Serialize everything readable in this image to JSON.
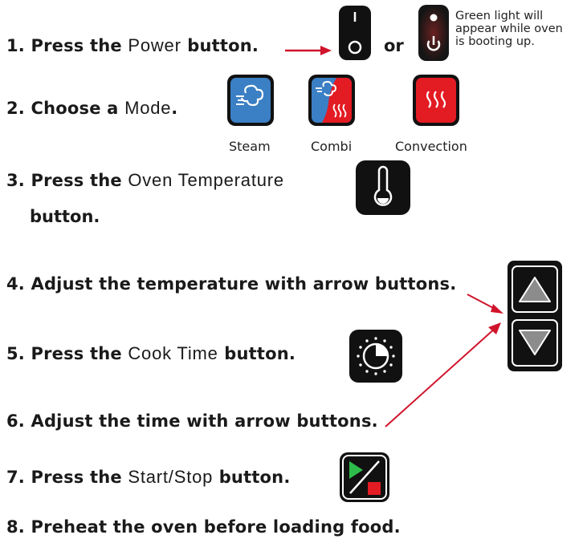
{
  "steps": {
    "s1": {
      "pre": "1. Press the ",
      "kw": "Power",
      "post": " button."
    },
    "or": "or",
    "note": [
      "Green light will",
      "appear while oven",
      "is booting up."
    ],
    "s2": {
      "pre": "2. Choose a ",
      "kw": "Mode",
      "post": "."
    },
    "modes": [
      "Steam",
      "Combi",
      "Convection"
    ],
    "s3": {
      "pre": "3. Press the ",
      "kw": "Oven Temperature",
      "post": "",
      "cont": "button."
    },
    "s4": {
      "text": "4. Adjust the temperature with arrow buttons."
    },
    "s5": {
      "pre": "5. Press the ",
      "kw": "Cook Time",
      "post": " button."
    },
    "s6": {
      "text": "6. Adjust the time with arrow buttons."
    },
    "s7": {
      "pre": "7. Press the ",
      "kw": "Start/Stop",
      "post": " button."
    },
    "s8": {
      "text": "8. Preheat the oven before loading food."
    }
  },
  "colors": {
    "arrow_red": "#d0142c",
    "steam_blue": "#3b7fc4",
    "convection_red": "#e31b23",
    "start_green": "#2ebd4a",
    "button_black": "#111111",
    "arrow_grey": "#8c8c8c",
    "power_light": "#ffffff"
  },
  "icons": [
    "power-off-icon",
    "power-on-icon",
    "steam-icon",
    "combi-icon",
    "convection-icon",
    "thermometer-icon",
    "arrow-up-icon",
    "arrow-down-icon",
    "timer-dial-icon",
    "start-stop-icon"
  ]
}
